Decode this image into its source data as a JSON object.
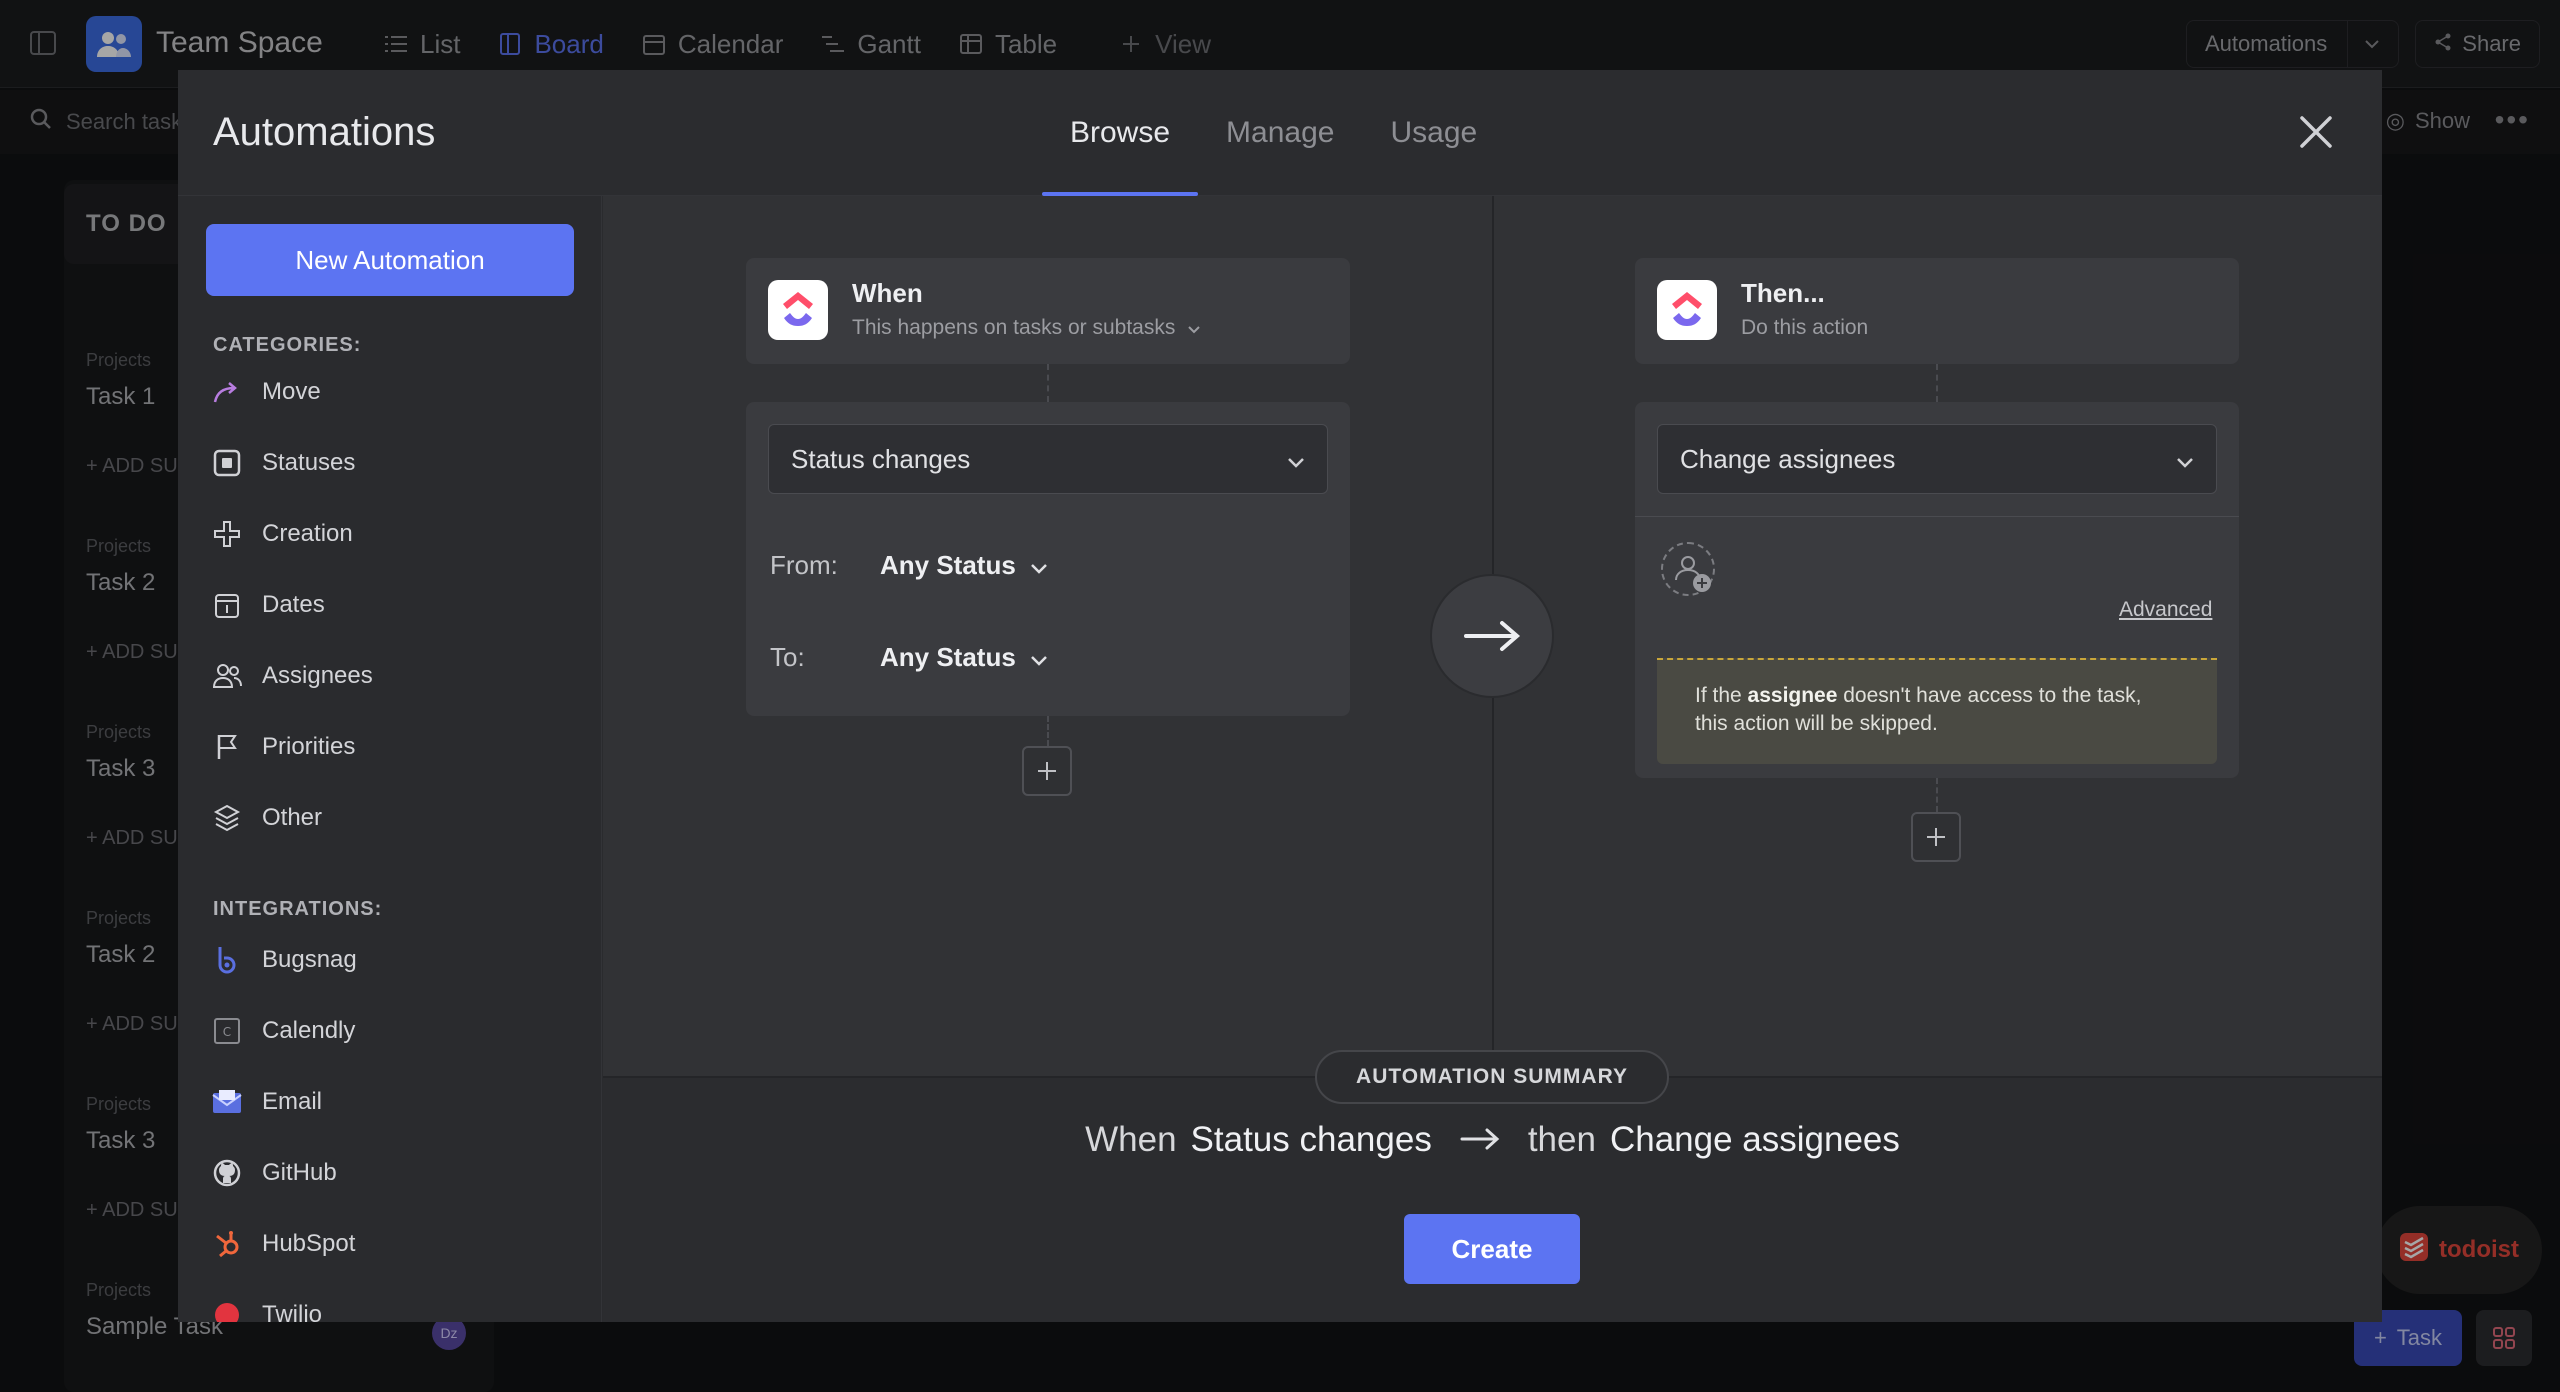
{
  "topbar": {
    "space_name": "Team Space",
    "tabs": [
      {
        "label": "List",
        "icon": "list-icon",
        "active": false
      },
      {
        "label": "Board",
        "icon": "board-icon",
        "active": true
      },
      {
        "label": "Calendar",
        "icon": "calendar-icon",
        "active": false
      },
      {
        "label": "Gantt",
        "icon": "gantt-icon",
        "active": false
      },
      {
        "label": "Table",
        "icon": "table-icon",
        "active": false
      },
      {
        "label": "View",
        "icon": "plus-icon",
        "active": false
      }
    ],
    "automations_label": "Automations",
    "share_label": "Share"
  },
  "subbar": {
    "search_placeholder": "Search tasks",
    "show_label": "Show"
  },
  "board": {
    "column_title": "TO DO",
    "cards": [
      {
        "crumb": "Projects",
        "name": "Task 1",
        "add": "+ ADD SU"
      },
      {
        "crumb": "Projects",
        "name": "Task 2",
        "add": "+ ADD SU"
      },
      {
        "crumb": "Projects",
        "name": "Task 3",
        "add": "+ ADD SU"
      },
      {
        "crumb": "Projects",
        "name": "Task 2",
        "add": "+ ADD SU"
      },
      {
        "crumb": "Projects",
        "name": "Task 3",
        "add": "+ ADD SU"
      },
      {
        "crumb": "Projects",
        "name": "Sample Task",
        "add": ""
      }
    ],
    "avatar_initials": "Dz"
  },
  "floating": {
    "todoist_label": "todoist",
    "task_label": "Task"
  },
  "modal": {
    "title": "Automations",
    "tabs": [
      "Browse",
      "Manage",
      "Usage"
    ],
    "active_tab": "Browse",
    "sidebar": {
      "new_button": "New Automation",
      "categories_label": "CATEGORIES:",
      "categories": [
        {
          "label": "Move",
          "icon": "move-icon"
        },
        {
          "label": "Statuses",
          "icon": "statuses-icon"
        },
        {
          "label": "Creation",
          "icon": "creation-icon"
        },
        {
          "label": "Dates",
          "icon": "dates-icon"
        },
        {
          "label": "Assignees",
          "icon": "assignees-icon"
        },
        {
          "label": "Priorities",
          "icon": "priorities-icon"
        },
        {
          "label": "Other",
          "icon": "other-icon"
        }
      ],
      "integrations_label": "INTEGRATIONS:",
      "integrations": [
        {
          "label": "Bugsnag",
          "icon": "bugsnag-icon"
        },
        {
          "label": "Calendly",
          "icon": "calendly-icon"
        },
        {
          "label": "Email",
          "icon": "email-icon"
        },
        {
          "label": "GitHub",
          "icon": "github-icon"
        },
        {
          "label": "HubSpot",
          "icon": "hubspot-icon"
        },
        {
          "label": "Twilio",
          "icon": "twilio-icon"
        }
      ]
    },
    "trigger": {
      "title": "When",
      "subtitle": "This happens on tasks or subtasks",
      "select_value": "Status changes",
      "from_label": "From:",
      "from_value": "Any Status",
      "to_label": "To:",
      "to_value": "Any Status"
    },
    "action": {
      "title": "Then...",
      "subtitle": "Do this action",
      "select_value": "Change assignees",
      "advanced_label": "Advanced",
      "warning_pre": "If the ",
      "warning_bold": "assignee",
      "warning_post": " doesn't have access to the task,",
      "warning_line2": "this action will be skipped."
    },
    "summary": {
      "pill": "AUTOMATION SUMMARY",
      "when": "When",
      "trigger": "Status changes",
      "then": "then",
      "action": "Change assignees"
    },
    "create_button": "Create"
  },
  "colors": {
    "accent": "#5c74f2",
    "warning_border": "#c9a63a",
    "todoist": "#e4483d"
  }
}
